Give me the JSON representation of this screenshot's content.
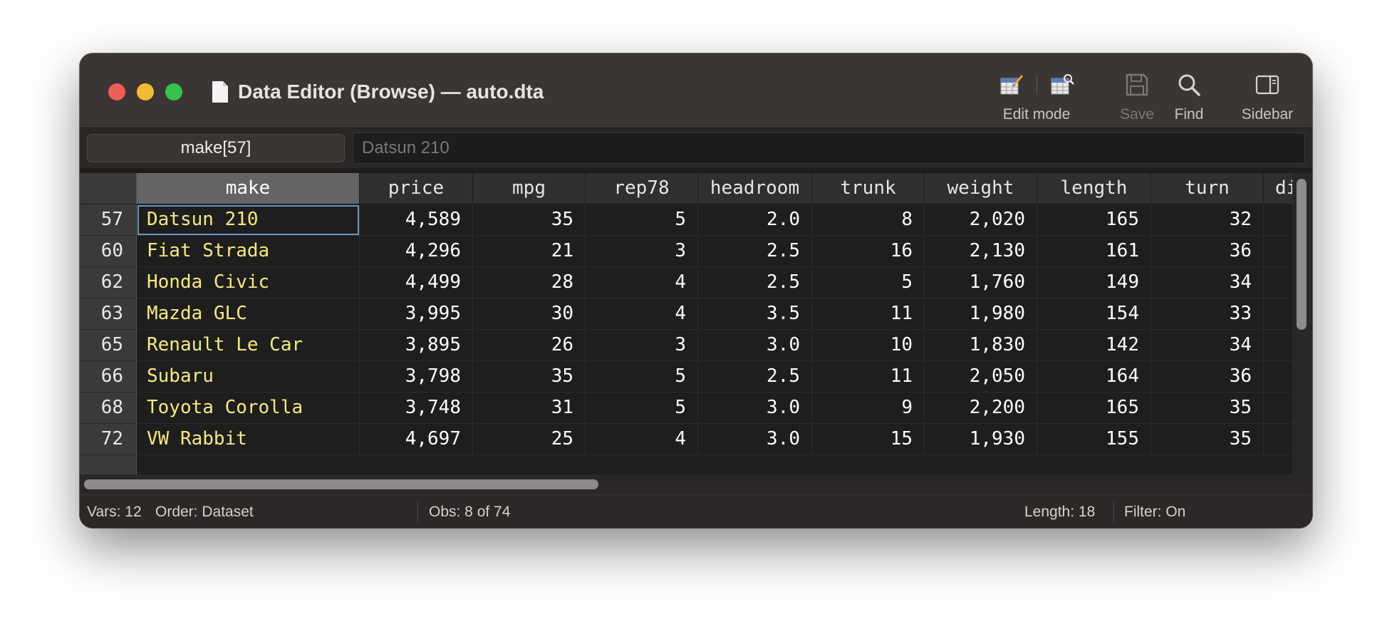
{
  "window": {
    "title": "Data Editor (Browse) — auto.dta"
  },
  "toolbar": {
    "edit_mode_label": "Edit mode",
    "save_label": "Save",
    "find_label": "Find",
    "sidebar_label": "Sidebar"
  },
  "varbar": {
    "current_cell": "make[57]",
    "current_value": "Datsun 210"
  },
  "grid": {
    "columns": [
      "make",
      "price",
      "mpg",
      "rep78",
      "headroom",
      "trunk",
      "weight",
      "length",
      "turn",
      "di"
    ],
    "rows": [
      {
        "obs": "57",
        "cells": [
          "Datsun 210",
          "4,589",
          "35",
          "5",
          "2.0",
          "8",
          "2,020",
          "165",
          "32",
          ""
        ]
      },
      {
        "obs": "60",
        "cells": [
          "Fiat Strada",
          "4,296",
          "21",
          "3",
          "2.5",
          "16",
          "2,130",
          "161",
          "36",
          ""
        ]
      },
      {
        "obs": "62",
        "cells": [
          "Honda Civic",
          "4,499",
          "28",
          "4",
          "2.5",
          "5",
          "1,760",
          "149",
          "34",
          ""
        ]
      },
      {
        "obs": "63",
        "cells": [
          "Mazda GLC",
          "3,995",
          "30",
          "4",
          "3.5",
          "11",
          "1,980",
          "154",
          "33",
          ""
        ]
      },
      {
        "obs": "65",
        "cells": [
          "Renault Le Car",
          "3,895",
          "26",
          "3",
          "3.0",
          "10",
          "1,830",
          "142",
          "34",
          ""
        ]
      },
      {
        "obs": "66",
        "cells": [
          "Subaru",
          "3,798",
          "35",
          "5",
          "2.5",
          "11",
          "2,050",
          "164",
          "36",
          ""
        ]
      },
      {
        "obs": "68",
        "cells": [
          "Toyota Corolla",
          "3,748",
          "31",
          "5",
          "3.0",
          "9",
          "2,200",
          "165",
          "35",
          ""
        ]
      },
      {
        "obs": "72",
        "cells": [
          "VW Rabbit",
          "4,697",
          "25",
          "4",
          "3.0",
          "15",
          "1,930",
          "155",
          "35",
          ""
        ]
      }
    ]
  },
  "status": {
    "vars": "Vars: 12",
    "order": "Order: Dataset",
    "obs": "Obs: 8 of 74",
    "length": "Length: 18",
    "filter": "Filter: On"
  },
  "colors": {
    "titlebar": "#3b3534",
    "string_text": "#f7ea7c",
    "numeric_text": "#ffffff",
    "selection_outline": "#6c94c7",
    "close": "#ec5f57",
    "minimize": "#f1bc32",
    "maximize": "#37c24b"
  },
  "icons": [
    "document-icon",
    "edit-mode-icon",
    "browse-mode-icon",
    "save-icon",
    "search-icon",
    "sidebar-icon"
  ]
}
